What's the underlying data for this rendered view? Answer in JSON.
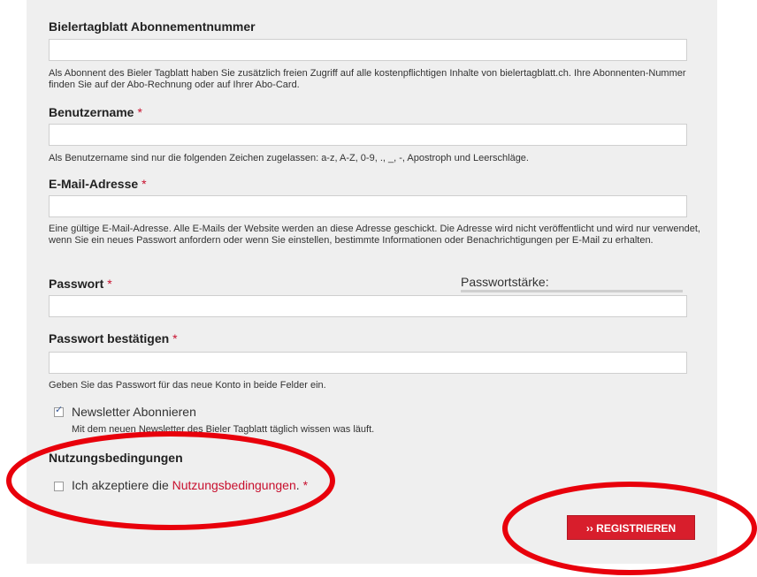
{
  "form": {
    "abo": {
      "label": "Bielertagblatt Abonnementnummer",
      "value": "",
      "description": "Als Abonnent des Bieler Tagblatt haben Sie zusätzlich freien Zugriff auf alle kostenpflichtigen Inhalte von bielertagblatt.ch. Ihre Abonnenten-Nummer finden Sie auf der Abo-Rechnung oder auf Ihrer Abo-Card."
    },
    "username": {
      "label": "Benutzername",
      "required_mark": "*",
      "value": "",
      "description": "Als Benutzername sind nur die folgenden Zeichen zugelassen: a-z, A-Z, 0-9, ., _, -, Apostroph und Leerschläge."
    },
    "email": {
      "label": "E-Mail-Adresse",
      "required_mark": "*",
      "value": "",
      "description": "Eine gültige E-Mail-Adresse. Alle E-Mails der Website werden an diese Adresse geschickt. Die Adresse wird nicht veröffentlicht und wird nur verwendet, wenn Sie ein neues Passwort anfordern oder wenn Sie einstellen, bestimmte Informationen oder Benachrichtigungen per E-Mail zu erhalten."
    },
    "password": {
      "label": "Passwort",
      "required_mark": "*",
      "value": "",
      "strength_label": "Passwortstärke:"
    },
    "password_confirm": {
      "label": "Passwort bestätigen",
      "required_mark": "*",
      "value": "",
      "description": "Geben Sie das Passwort für das neue Konto in beide Felder ein."
    },
    "newsletter": {
      "label": "Newsletter Abonnieren",
      "checked": true,
      "description": "Mit dem neuen Newsletter des Bieler Tagblatt täglich wissen was läuft."
    },
    "terms": {
      "heading": "Nutzungsbedingungen",
      "label_prefix": "Ich akzeptiere die ",
      "link_text": "Nutzungsbedingungen",
      "label_suffix": ".",
      "required_mark": "*",
      "checked": false
    },
    "submit_label": "›› REGISTRIEREN"
  },
  "colors": {
    "panel_bg": "#efefef",
    "accent_red": "#d81e2c",
    "required_red": "#c8102e",
    "annotation_red": "#e8000b"
  }
}
